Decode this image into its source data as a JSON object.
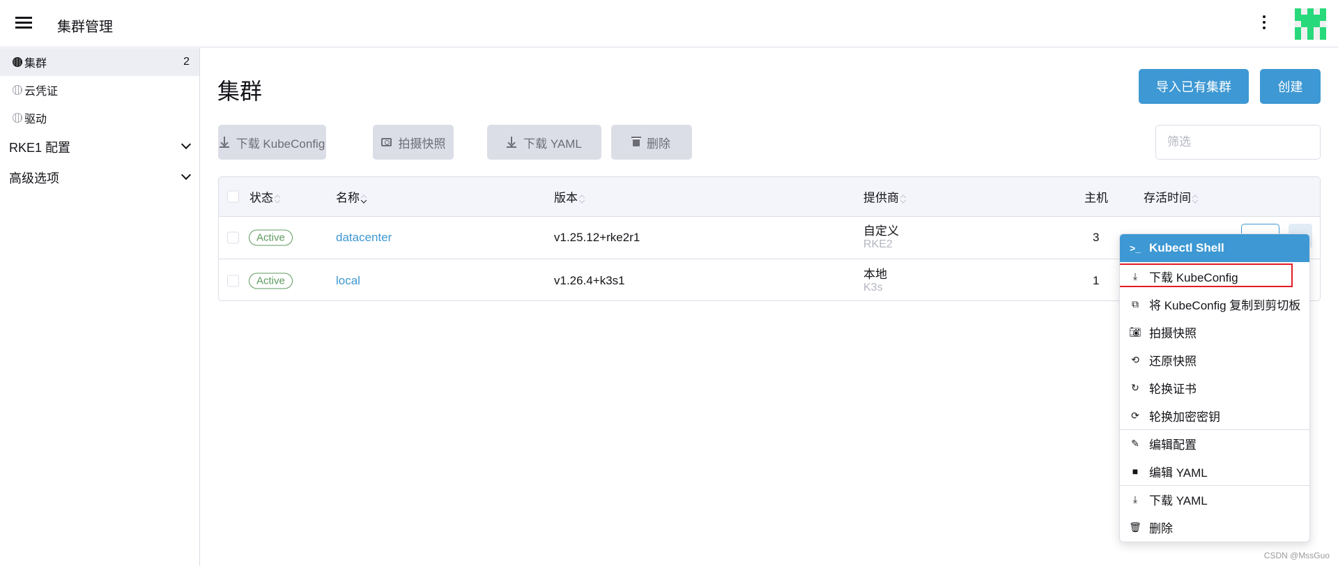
{
  "header": {
    "title": "集群管理",
    "logo_color": "#27d97a"
  },
  "sidebar": {
    "items": [
      {
        "label": "集群",
        "count": "2",
        "icon": "globe-icon",
        "active": true
      },
      {
        "label": "云凭证",
        "icon": "globe-icon"
      },
      {
        "label": "驱动",
        "icon": "globe-icon"
      }
    ],
    "groups": [
      {
        "label": "RKE1 配置"
      },
      {
        "label": "高级选项"
      }
    ]
  },
  "main": {
    "title": "集群",
    "import_label": "导入已有集群",
    "create_label": "创建",
    "toolbar": {
      "download_kubeconfig": "下载 KubeConfig",
      "snapshot": "拍摄快照",
      "download_yaml": "下载 YAML",
      "delete": "删除"
    },
    "filter_placeholder": "筛选",
    "table": {
      "columns": [
        "状态",
        "名称",
        "版本",
        "提供商",
        "主机",
        "存活时间"
      ],
      "rows": [
        {
          "status": "Active",
          "name": "datacenter",
          "version": "v1.25.12+rke2r1",
          "provider": "自定义",
          "provider_sub": "RKE2",
          "hosts": "3"
        },
        {
          "status": "Active",
          "name": "local",
          "version": "v1.26.4+k3s1",
          "provider": "本地",
          "provider_sub": "K3s",
          "hosts": "1"
        }
      ]
    }
  },
  "menu": {
    "items": [
      {
        "label": "Kubectl Shell",
        "icon": "terminal-icon"
      },
      {
        "label": "下载 KubeConfig",
        "icon": "download-icon"
      },
      {
        "label": "将 KubeConfig 复制到剪切板",
        "icon": "copy-icon"
      },
      {
        "label": "拍摄快照",
        "icon": "camera-icon"
      },
      {
        "label": "还原快照",
        "icon": "restore-icon"
      },
      {
        "label": "轮换证书",
        "icon": "rotate-icon"
      },
      {
        "label": "轮换加密密钥",
        "icon": "refresh-icon"
      },
      {
        "label": "编辑配置",
        "icon": "pencil-icon"
      },
      {
        "label": "编辑 YAML",
        "icon": "file-icon"
      },
      {
        "label": "下载 YAML",
        "icon": "download-icon"
      },
      {
        "label": "删除",
        "icon": "trash-icon"
      }
    ]
  },
  "colors": {
    "primary": "#3d98d3",
    "active_badge": "#5d995d",
    "highlight_box": "#e21b25"
  },
  "watermark": "CSDN @MssGuo"
}
